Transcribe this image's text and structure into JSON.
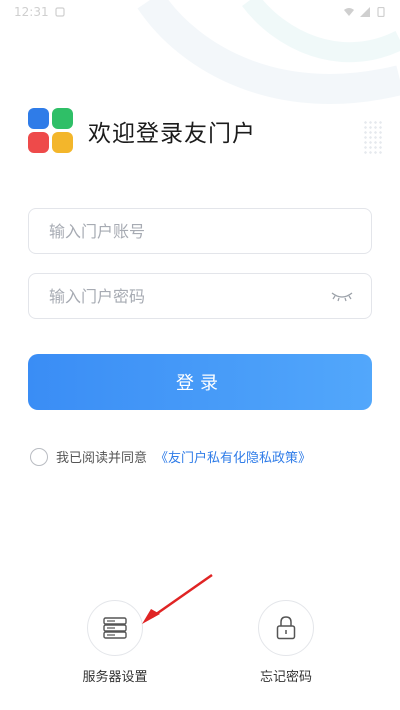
{
  "status_bar": {
    "time": "12:31"
  },
  "header": {
    "app_title": "欢迎登录友门户"
  },
  "form": {
    "account_placeholder": "输入门户账号",
    "password_placeholder": "输入门户密码",
    "login_label": "登录"
  },
  "agreement": {
    "prefix": "我已阅读并同意",
    "policy_link": "《友门户私有化隐私政策》"
  },
  "bottom": {
    "server_settings_label": "服务器设置",
    "forgot_password_label": "忘记密码"
  },
  "colors": {
    "primary": "#3a8df5",
    "link": "#2f7ce8",
    "annotation_arrow": "#e02424"
  }
}
